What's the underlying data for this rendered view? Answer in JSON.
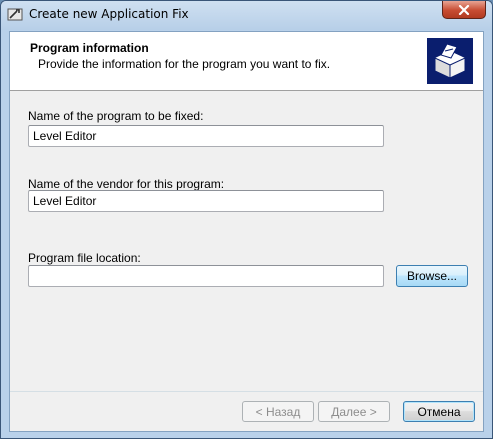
{
  "window": {
    "title": "Create new Application Fix",
    "icons": {
      "app": "wrench-app-icon",
      "close": "close-icon"
    }
  },
  "header": {
    "title": "Program information",
    "subtitle": "Provide the information for the program you want to fix.",
    "icon": "program-box-icon"
  },
  "form": {
    "program_name_label": "Name of the program to be fixed:",
    "program_name_value": "Level Editor",
    "vendor_label": "Name of the vendor for this program:",
    "vendor_value": "Level Editor",
    "file_location_label": "Program file location:",
    "file_location_value": "",
    "browse_label": "Browse..."
  },
  "footer": {
    "back_label": "< Назад",
    "next_label": "Далее >",
    "cancel_label": "Отмена"
  },
  "colors": {
    "frame": "#b9d1ea",
    "close_button": "#c74c32",
    "focus_blue": "#3c7fb1"
  }
}
